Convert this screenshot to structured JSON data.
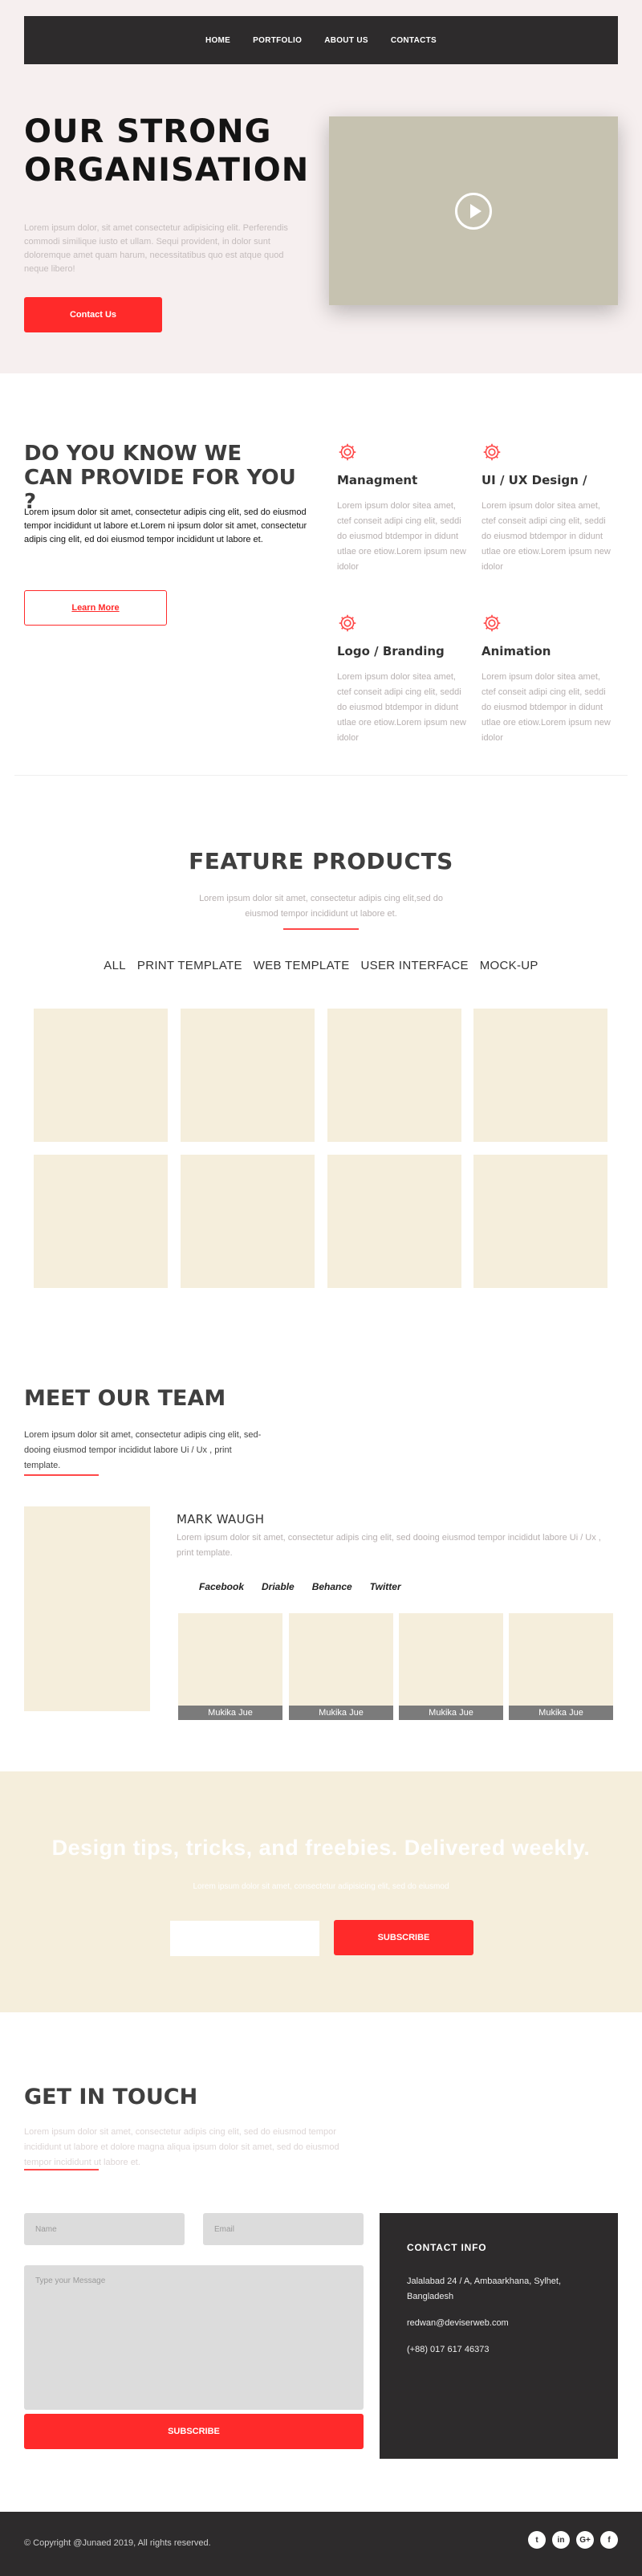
{
  "nav": {
    "items": [
      "HOME",
      "PORTFOLIO",
      "ABOUT US",
      "CONTACTS"
    ]
  },
  "hero": {
    "title_line1": "OUR STRONG",
    "title_line2": "ORGANISATION",
    "text": "Lorem ipsum dolor, sit amet consectetur adipisicing elit. Perferendis commodi similique iusto et ullam. Sequi provident, in dolor sunt doloremque amet quam harum, necessitatibus quo est atque quod neque libero!",
    "button": "Contact Us"
  },
  "know": {
    "title": "DO YOU KNOW WE CAN PROVIDE FOR YOU ?",
    "text": "Lorem ipsum dolor sit amet, consectetur adipis cing elit, sed do eiusmod tempor incididunt ut labore et.Lorem ni ipsum dolor sit amet, consectetur adipis cing elit, ed doi eiusmod tempor incididunt ut labore et.",
    "button": "Learn More",
    "services": [
      {
        "title": "Managment",
        "text": "Lorem ipsum dolor sitea amet, ctef conseit adipi cing elit, seddi do eiusmod btdempor in didunt utlae ore etiow.Lorem ipsum new idolor"
      },
      {
        "title": "UI / UX Design /",
        "text": "Lorem ipsum dolor sitea amet, ctef conseit adipi cing elit, seddi do eiusmod btdempor in didunt utlae ore etiow.Lorem ipsum new idolor"
      },
      {
        "title": "Logo / Branding",
        "text": "Lorem ipsum dolor sitea amet, ctef conseit adipi cing elit, seddi do eiusmod btdempor in didunt utlae ore etiow.Lorem ipsum new idolor"
      },
      {
        "title": "Animation",
        "text": "Lorem ipsum dolor sitea amet, ctef conseit adipi cing elit, seddi do eiusmod btdempor in didunt utlae ore etiow.Lorem ipsum new idolor"
      }
    ]
  },
  "feature": {
    "title": "FEATURE PRODUCTS",
    "subtitle": "Lorem ipsum dolor sit amet, consectetur adipis cing elit,sed do eiusmod tempor incididunt ut labore et.",
    "filters": [
      "ALL",
      "PRINT TEMPLATE",
      "WEB TEMPLATE",
      "USER INTERFACE",
      "MOCK-UP"
    ]
  },
  "team": {
    "title": "MEET OUR TEAM",
    "text": "Lorem ipsum dolor sit amet, consectetur adipis cing elit, sed-dooing eiusmod tempor incididut labore Ui / Ux , print template.",
    "member_name": "MARK WAUGH",
    "member_text": "Lorem ipsum dolor sit amet, consectetur adipis cing elit, sed dooing eiusmod tempor incididut labore Ui / Ux , print template.",
    "socials": [
      "Facebook",
      "Driable",
      "Behance",
      "Twitter"
    ],
    "thumbs": [
      "Mukika Jue",
      "Mukika Jue",
      "Mukika Jue",
      "Mukika Jue"
    ]
  },
  "newsletter": {
    "title": "Design tips, tricks, and freebies. Delivered weekly.",
    "subtitle": "Lorem ipsum dolor sit amet, consectetur adipisicing elit, sed do eiusmod",
    "button": "SUBSCRIBE"
  },
  "contact": {
    "title": "GET IN TOUCH",
    "text": "Lorem ipsum dolor sit amet, consectetur adipis cing elit, sed do eiusmod tempor incididunt ut labore et dolore magna aliqua ipsum dolor sit amet, sed do eiusmod tempor incididunt ut labore et.",
    "name_placeholder": "Name",
    "email_placeholder": "Email",
    "message_placeholder": "Type your Message",
    "button": "SUBSCRIBE",
    "info": {
      "title": "CONTACT INFO",
      "address": "Jalalabad 24 / A, Ambaarkhana, Sylhet, Bangladesh",
      "email": "redwan@deviserweb.com",
      "phone": "(+88) 017 617 46373"
    }
  },
  "footer": {
    "copyright": "© Copyright @Junaed 2019, All rights reserved.",
    "social_icons": [
      "twitter-icon",
      "linkedin-icon",
      "google-plus-icon",
      "facebook-icon"
    ]
  }
}
